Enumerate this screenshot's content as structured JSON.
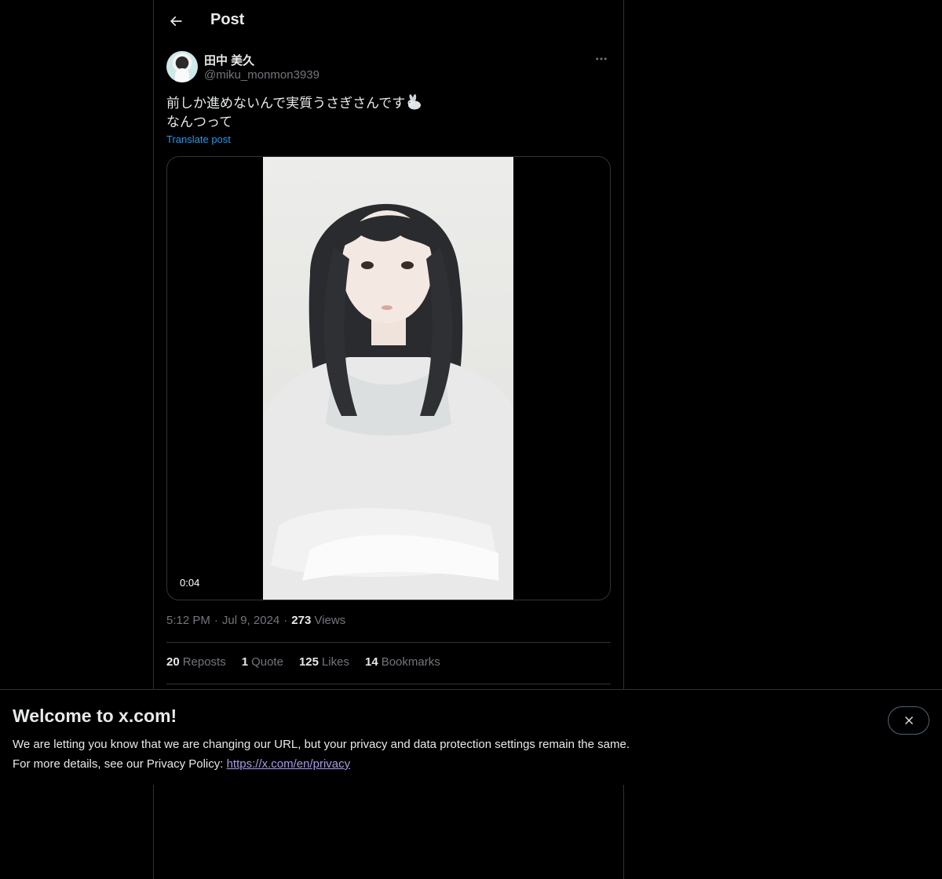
{
  "header": {
    "title": "Post",
    "back_icon": "arrow-left-icon"
  },
  "post": {
    "author_name": "田中 美久",
    "author_handle": "@miku_monmon3939",
    "text_line1": "前しか進めないんで実質うさぎさんです",
    "text_emoji": "rabbit-emoji",
    "text_line2": "なんつって",
    "translate_label": "Translate post",
    "video_duration": "0:04",
    "time": "5:12 PM",
    "date": "Jul 9, 2024",
    "views_count": "273",
    "views_label": "Views"
  },
  "stats": [
    {
      "count": "20",
      "label": "Reposts"
    },
    {
      "count": "1",
      "label": "Quote"
    },
    {
      "count": "125",
      "label": "Likes"
    },
    {
      "count": "14",
      "label": "Bookmarks"
    }
  ],
  "banner": {
    "title": "Welcome to x.com!",
    "line1": "We are letting you know that we are changing our URL, but your privacy and data protection settings remain the same.",
    "line2_prefix": "For more details, see our Privacy Policy: ",
    "link_text": "https://x.com/en/privacy"
  },
  "colors": {
    "background": "#000000",
    "text": "#e7e9ea",
    "muted": "#71767b",
    "accent": "#1d9bf0",
    "border": "#2f3336",
    "link_visited": "#a49ce6"
  }
}
